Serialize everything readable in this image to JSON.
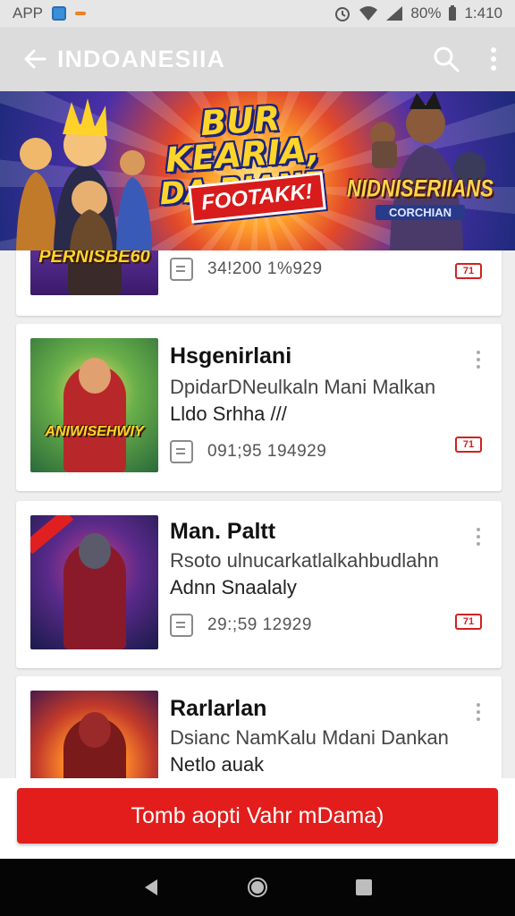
{
  "status_bar": {
    "left_label": "APP",
    "battery": "80%",
    "time": "1:410"
  },
  "app_bar": {
    "title": "INDOANESIIA",
    "icons": [
      "back-arrow-icon",
      "search-icon",
      "more-vert-icon"
    ]
  },
  "banner": {
    "headline_line1": "BUR KEARIA,",
    "headline_line2": "DA RIANE",
    "tag": "FOOTAKK!",
    "right_title": "NIDNISERIIANS",
    "right_subtitle": "CORCHIAN"
  },
  "items": [
    {
      "thumb_caption": "PERNISBE60",
      "name": "",
      "description": "",
      "subtitle": "",
      "stats": "34!200  1%929",
      "badge": "71"
    },
    {
      "thumb_caption": "ANIWISEHWIY",
      "name": "Hsgenirlani",
      "description": "DpidarDNeulkaln Mani Malkan",
      "subtitle": "Lldo Srhha ///",
      "stats": "091;95  194929",
      "badge": "71"
    },
    {
      "thumb_caption": "",
      "name": "Man. Paltt",
      "description": "Rsoto ulnucarkatlalkahbudlahn",
      "subtitle": "Adnn Snaalaly",
      "stats": "29:;59   12929",
      "badge": "71"
    },
    {
      "thumb_caption": "",
      "name": "Rarlarlan",
      "description": "Dsianc NamKalu Mdani Dankan",
      "subtitle": "Netlo auak",
      "stats": "",
      "badge": ""
    }
  ],
  "cta": {
    "label": "Tomb aopti Vahr mDama)"
  },
  "colors": {
    "accent": "#e21d1b",
    "appbar": "#dcdcdc",
    "background": "#eeeeee"
  }
}
